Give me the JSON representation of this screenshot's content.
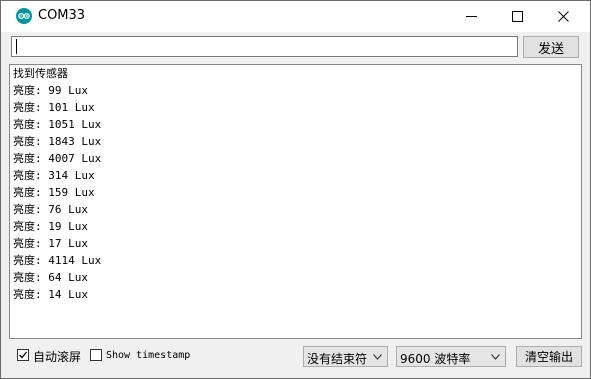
{
  "window": {
    "title": "COM33"
  },
  "input": {
    "value": "",
    "send_label": "发送"
  },
  "output": {
    "lines": [
      "找到传感器",
      "亮度: 99 Lux",
      "亮度: 101 Lux",
      "亮度: 1051 Lux",
      "亮度: 1843 Lux",
      "亮度: 4007 Lux",
      "亮度: 314 Lux",
      "亮度: 159 Lux",
      "亮度: 76 Lux",
      "亮度: 19 Lux",
      "亮度: 17 Lux",
      "亮度: 4114 Lux",
      "亮度: 64 Lux",
      "亮度: 14 Lux"
    ]
  },
  "bottom": {
    "autoscroll_label": "自动滚屏",
    "autoscroll_checked": true,
    "timestamp_label": "Show timestamp",
    "timestamp_checked": false,
    "line_ending_selected": "没有结束符",
    "baud_selected": "9600 波特率",
    "clear_label": "清空输出"
  },
  "icons": {
    "app": "arduino-icon",
    "minimize": "minimize-icon",
    "maximize": "maximize-icon",
    "close": "close-icon",
    "checkmark": "checkmark-icon",
    "dropdown": "chevron-down-icon"
  },
  "colors": {
    "arduino_teal": "#00979c",
    "window_bg": "#f0f0f0",
    "output_bg": "#ffffff"
  }
}
